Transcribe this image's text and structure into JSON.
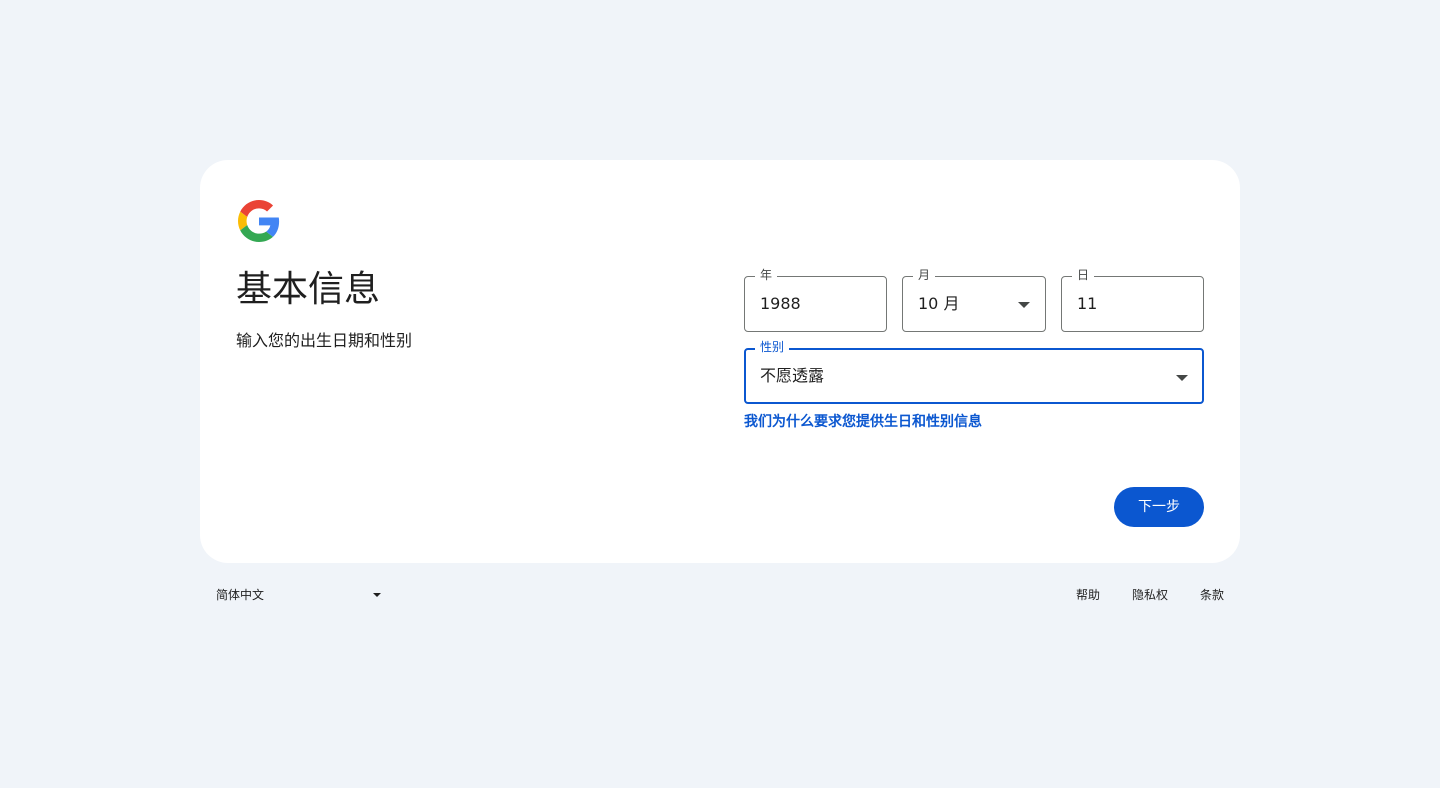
{
  "card": {
    "title": "基本信息",
    "subtitle": "输入您的出生日期和性别"
  },
  "form": {
    "year": {
      "label": "年",
      "value": "1988"
    },
    "month": {
      "label": "月",
      "value": "10 月"
    },
    "day": {
      "label": "日",
      "value": "11"
    },
    "gender": {
      "label": "性别",
      "value": "不愿透露"
    },
    "why_link": "我们为什么要求您提供生日和性别信息",
    "next_label": "下一步"
  },
  "footer": {
    "language": "简体中文",
    "links": [
      "帮助",
      "隐私权",
      "条款"
    ]
  },
  "colors": {
    "accent": "#0b57d0",
    "background": "#f0f4f9",
    "card": "#ffffff"
  },
  "icons": {
    "logo": "google-g-logo",
    "dropdown": "caret-down-icon"
  }
}
